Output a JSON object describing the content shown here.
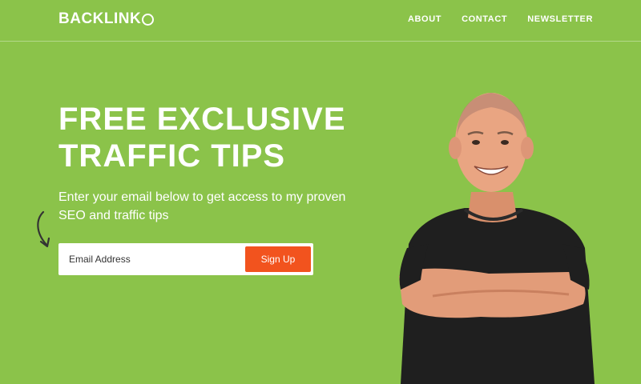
{
  "header": {
    "logo_text": "BACKLINK",
    "nav": [
      {
        "label": "ABOUT"
      },
      {
        "label": "CONTACT"
      },
      {
        "label": "NEWSLETTER"
      }
    ]
  },
  "hero": {
    "headline_line1": "FREE EXCLUSIVE",
    "headline_line2": "TRAFFIC TIPS",
    "subtext": "Enter your email below to get access to my proven SEO and traffic tips",
    "email_placeholder": "Email Address",
    "signup_label": "Sign Up"
  },
  "colors": {
    "background": "#8bc34a",
    "button": "#f2531e",
    "shirt": "#1f1f1f",
    "skin": "#e9a582"
  },
  "icons": {
    "logo_mark": "ring-o",
    "arrow": "curved-arrow-down-right"
  }
}
